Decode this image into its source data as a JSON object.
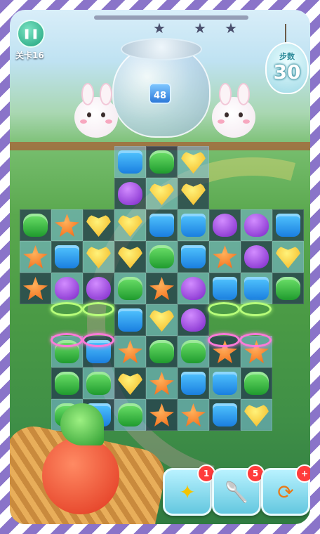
{
  "hud": {
    "pause_label": "❚❚",
    "level": "关卡16",
    "stars": [
      "★",
      "★",
      "★"
    ],
    "moves_label": "步数",
    "moves_value": "30",
    "target_count": "48",
    "target_icon": "blue-jelly-icon"
  },
  "board": {
    "colors": {
      "blue": "#2b9bf0",
      "green": "#2fb43a",
      "purple": "#9b3fe0",
      "yellow": "#f6c52a",
      "orange": "#f27a1e"
    },
    "rows": [
      [
        null,
        null,
        null,
        "blue",
        "green",
        "yellow",
        null,
        null,
        null
      ],
      [
        null,
        null,
        null,
        "purple",
        "yellow",
        "yellow",
        null,
        null,
        null
      ],
      [
        "green",
        "orange",
        "yellow",
        "yellow",
        "blue",
        "blue",
        "purple",
        "purple",
        "blue"
      ],
      [
        "orange",
        "blue",
        "yellow",
        "yellow",
        "green",
        "blue",
        "orange",
        "purple",
        "yellow"
      ],
      [
        "orange",
        "purple",
        "purple",
        "green",
        "orange",
        "purple",
        "blue",
        "blue",
        "green"
      ],
      [
        null,
        null,
        null,
        "blue",
        "yellow",
        "purple",
        null,
        null,
        null
      ],
      [
        null,
        "green",
        "blue",
        "orange",
        "green",
        "green",
        "orange",
        "orange",
        null
      ],
      [
        null,
        "green",
        "green",
        "yellow",
        "orange",
        "blue",
        "blue",
        "green",
        null
      ],
      [
        null,
        "green",
        "blue",
        "green",
        "orange",
        "orange",
        "blue",
        "yellow",
        null
      ]
    ]
  },
  "boosters": [
    {
      "name": "magic-wand-icon",
      "glyph": "✦",
      "count": "1"
    },
    {
      "name": "spoon-icon",
      "glyph": "🥄",
      "count": "5"
    },
    {
      "name": "shuffle-icon",
      "glyph": "⟳",
      "count": "+"
    }
  ]
}
